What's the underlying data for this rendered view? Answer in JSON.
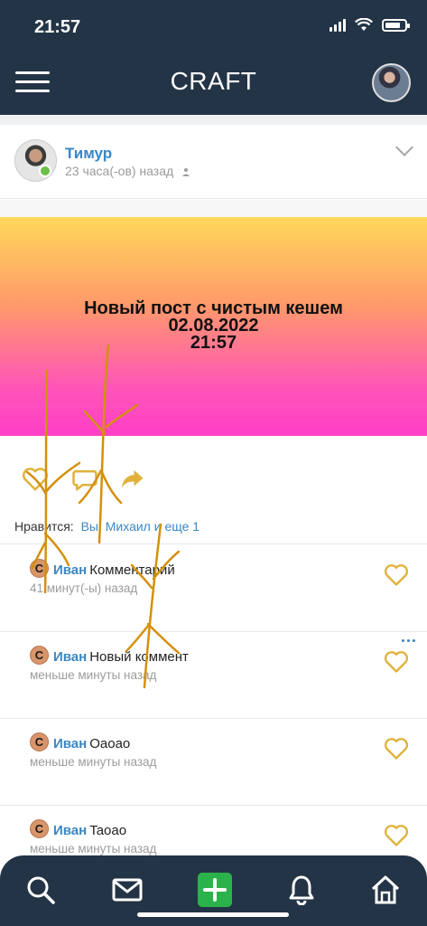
{
  "status_bar": {
    "time": "21:57"
  },
  "header": {
    "title": "CRAFT"
  },
  "post": {
    "author": "Тимур",
    "time": "23 часа(-ов) назад",
    "banner_lines": [
      "Новый пост с чистым кешем",
      "02.08.2022",
      "21:57"
    ],
    "banner_colors": [
      "#ffd85a",
      "#ff3ec7"
    ]
  },
  "likes": {
    "label": "Нравится:",
    "value": "Вы, Михаил и еще 1"
  },
  "comments": [
    {
      "badge": "С",
      "author": "Иван",
      "text": "Комментарий",
      "time": "41 минут(-ы) назад"
    },
    {
      "badge": "С",
      "author": "Иван",
      "text": "Новый коммент",
      "time": "меньше минуты назад"
    },
    {
      "badge": "С",
      "author": "Иван",
      "text": "Oaoao",
      "time": "меньше минуты назад"
    },
    {
      "badge": "С",
      "author": "Иван",
      "text": "Taoao",
      "time": "меньше минуты назад"
    }
  ],
  "bottom_nav": [
    "search-icon",
    "mail-icon",
    "plus-icon",
    "bell-icon",
    "home-icon"
  ],
  "colors": {
    "header_bg": "#233446",
    "accent_link": "#3b87c4",
    "heart": "#e0b23c",
    "add_button": "#2cb24a"
  }
}
